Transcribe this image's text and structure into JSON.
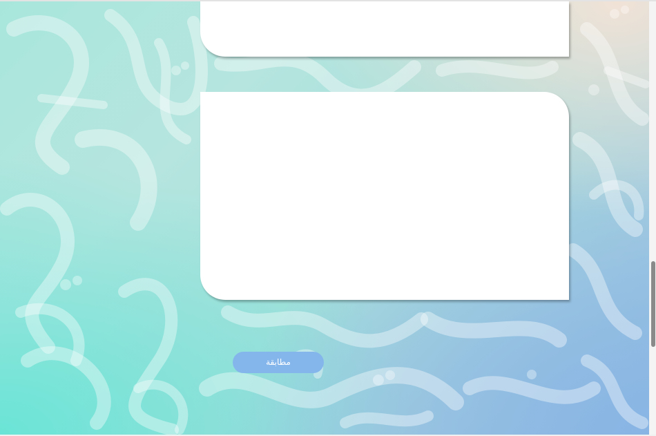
{
  "page": {
    "match_button_label": "مطابقة"
  },
  "colors": {
    "accent_button": "#84b6ec",
    "panel": "#ffffff",
    "background_teal": "#a8e6dc",
    "background_blue": "#96bee2"
  },
  "scrollbar": {
    "scroll_position_fraction": 0.6
  }
}
